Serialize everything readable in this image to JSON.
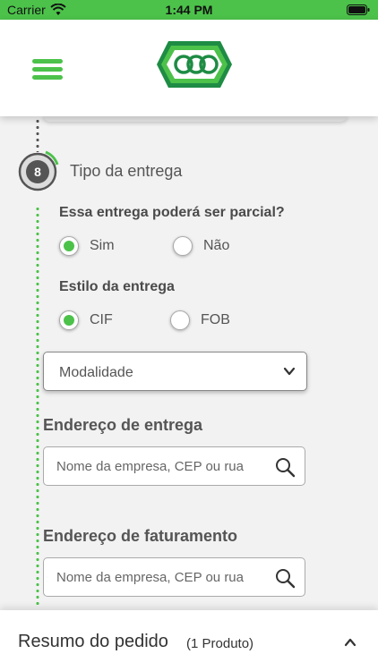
{
  "status_bar": {
    "carrier": "Carrier",
    "time": "1:44 PM"
  },
  "header": {
    "menu_icon": "hamburger-icon",
    "logo_text": "OCQ"
  },
  "step": {
    "number": "8",
    "title": "Tipo da entrega"
  },
  "partial": {
    "question": "Essa entrega poderá ser parcial?",
    "options": [
      {
        "label": "Sim",
        "selected": true
      },
      {
        "label": "Não",
        "selected": false
      }
    ]
  },
  "style": {
    "question": "Estilo da entrega",
    "options": [
      {
        "label": "CIF",
        "selected": true
      },
      {
        "label": "FOB",
        "selected": false
      }
    ]
  },
  "modalidade": {
    "value": "Modalidade"
  },
  "delivery_address": {
    "title": "Endereço de entrega",
    "placeholder": "Nome da empresa, CEP ou rua"
  },
  "billing_address": {
    "title": "Endereço de faturamento",
    "placeholder": "Nome da empresa, CEP ou rua"
  },
  "summary": {
    "title": "Resumo do pedido",
    "count": "(1 Produto)"
  },
  "colors": {
    "accent": "#4cc24a",
    "text": "#4a4a4a"
  }
}
